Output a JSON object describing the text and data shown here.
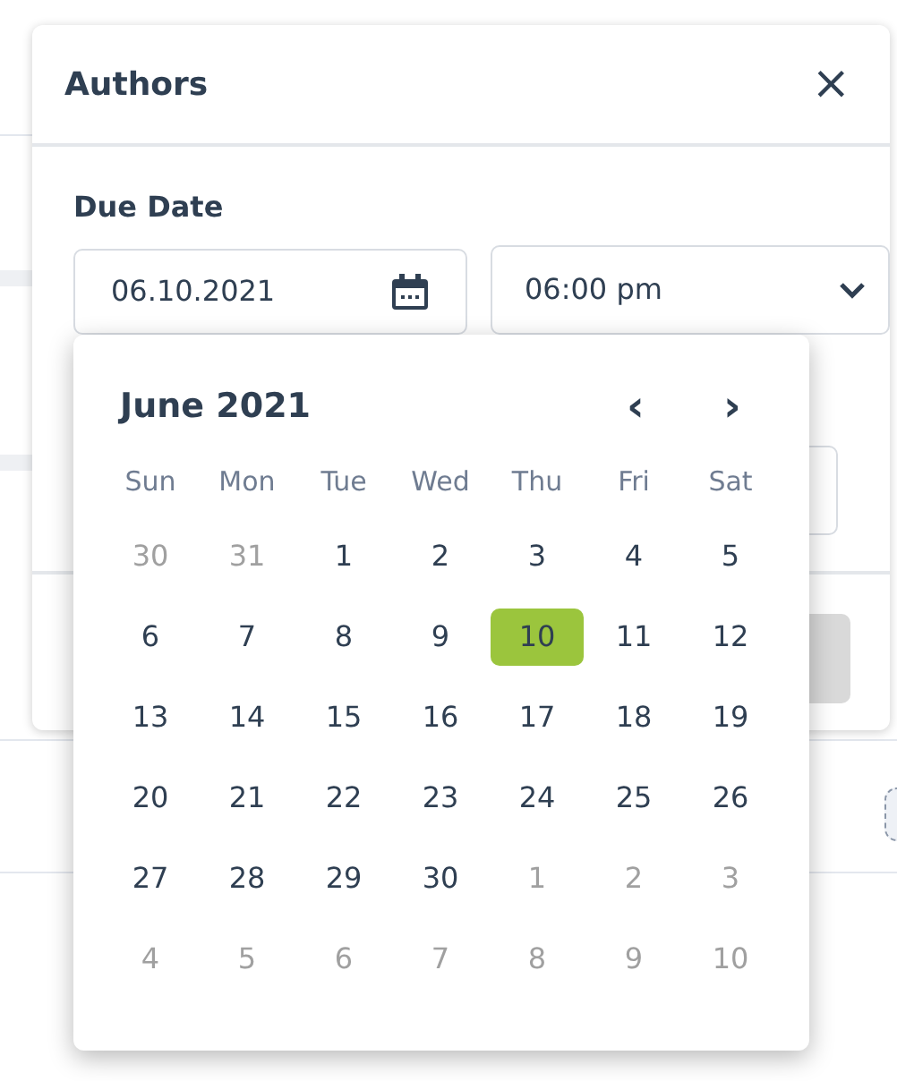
{
  "modal": {
    "title": "Authors",
    "close": "×"
  },
  "due_date": {
    "label": "Due Date",
    "date_value": "06.10.2021",
    "time_value": "06:00 pm"
  },
  "calendar": {
    "title": "June 2021",
    "prev": "‹",
    "next": "›",
    "weekdays": [
      "Sun",
      "Mon",
      "Tue",
      "Wed",
      "Thu",
      "Fri",
      "Sat"
    ],
    "weeks": [
      [
        {
          "day": "30",
          "outside": true,
          "selected": false
        },
        {
          "day": "31",
          "outside": true,
          "selected": false
        },
        {
          "day": "1",
          "outside": false,
          "selected": false
        },
        {
          "day": "2",
          "outside": false,
          "selected": false
        },
        {
          "day": "3",
          "outside": false,
          "selected": false
        },
        {
          "day": "4",
          "outside": false,
          "selected": false
        },
        {
          "day": "5",
          "outside": false,
          "selected": false
        }
      ],
      [
        {
          "day": "6",
          "outside": false,
          "selected": false
        },
        {
          "day": "7",
          "outside": false,
          "selected": false
        },
        {
          "day": "8",
          "outside": false,
          "selected": false
        },
        {
          "day": "9",
          "outside": false,
          "selected": false
        },
        {
          "day": "10",
          "outside": false,
          "selected": true
        },
        {
          "day": "11",
          "outside": false,
          "selected": false
        },
        {
          "day": "12",
          "outside": false,
          "selected": false
        }
      ],
      [
        {
          "day": "13",
          "outside": false,
          "selected": false
        },
        {
          "day": "14",
          "outside": false,
          "selected": false
        },
        {
          "day": "15",
          "outside": false,
          "selected": false
        },
        {
          "day": "16",
          "outside": false,
          "selected": false
        },
        {
          "day": "17",
          "outside": false,
          "selected": false
        },
        {
          "day": "18",
          "outside": false,
          "selected": false
        },
        {
          "day": "19",
          "outside": false,
          "selected": false
        }
      ],
      [
        {
          "day": "20",
          "outside": false,
          "selected": false
        },
        {
          "day": "21",
          "outside": false,
          "selected": false
        },
        {
          "day": "22",
          "outside": false,
          "selected": false
        },
        {
          "day": "23",
          "outside": false,
          "selected": false
        },
        {
          "day": "24",
          "outside": false,
          "selected": false
        },
        {
          "day": "25",
          "outside": false,
          "selected": false
        },
        {
          "day": "26",
          "outside": false,
          "selected": false
        }
      ],
      [
        {
          "day": "27",
          "outside": false,
          "selected": false
        },
        {
          "day": "28",
          "outside": false,
          "selected": false
        },
        {
          "day": "29",
          "outside": false,
          "selected": false
        },
        {
          "day": "30",
          "outside": false,
          "selected": false
        },
        {
          "day": "1",
          "outside": true,
          "selected": false
        },
        {
          "day": "2",
          "outside": true,
          "selected": false
        },
        {
          "day": "3",
          "outside": true,
          "selected": false
        }
      ],
      [
        {
          "day": "4",
          "outside": true,
          "selected": false
        },
        {
          "day": "5",
          "outside": true,
          "selected": false
        },
        {
          "day": "6",
          "outside": true,
          "selected": false
        },
        {
          "day": "7",
          "outside": true,
          "selected": false
        },
        {
          "day": "8",
          "outside": true,
          "selected": false
        },
        {
          "day": "9",
          "outside": true,
          "selected": false
        },
        {
          "day": "10",
          "outside": true,
          "selected": false
        }
      ]
    ]
  }
}
